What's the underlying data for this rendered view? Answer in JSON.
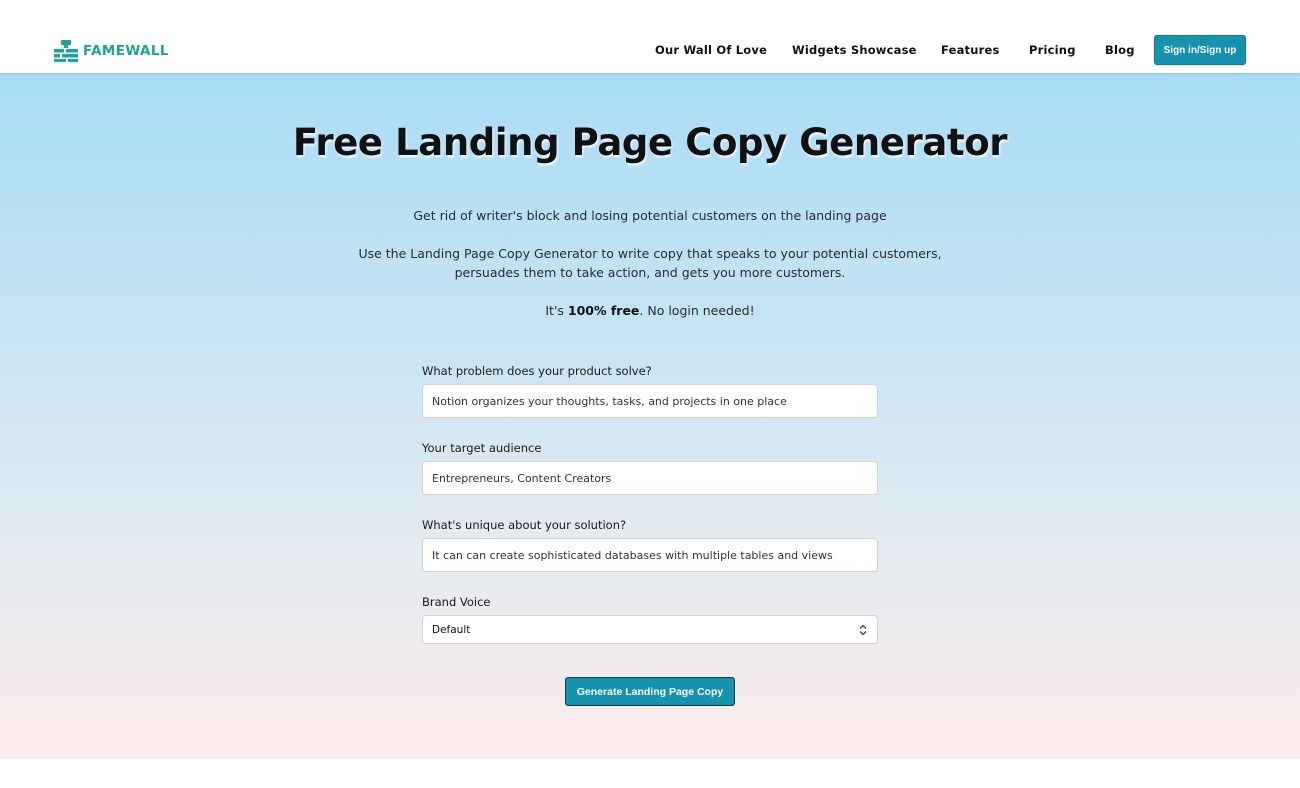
{
  "brand": {
    "name": "FAMEWALL",
    "accent_color": "#1ba39c",
    "icon": "trophy-wall-icon"
  },
  "nav": {
    "links": [
      "Our Wall Of Love",
      "Widgets Showcase",
      "Features",
      "Pricing",
      "Blog"
    ],
    "signin_label": "Sign in/Sign up",
    "button_color": "#1592ad"
  },
  "hero": {
    "title": "Free Landing Page Copy Generator",
    "intro": "Get rid of writer's block and losing potential customers on the landing page",
    "description": "Use the Landing Page Copy Generator to write copy that speaks to your potential customers, persuades them to take action, and gets you more customers.",
    "free_prefix": "It's ",
    "free_bold": "100% free",
    "free_suffix": ". No login needed!"
  },
  "form": {
    "fields": [
      {
        "label": "What problem does your product solve?",
        "value": "Notion organizes your thoughts, tasks, and projects in one place"
      },
      {
        "label": "Your target audience",
        "value": "Entrepreneurs, Content Creators"
      },
      {
        "label": "What's unique about your solution?",
        "value": "It can can create sophisticated databases with multiple tables and views"
      }
    ],
    "brand_voice": {
      "label": "Brand Voice",
      "selected": "Default"
    },
    "submit_label": "Generate Landing Page Copy"
  }
}
